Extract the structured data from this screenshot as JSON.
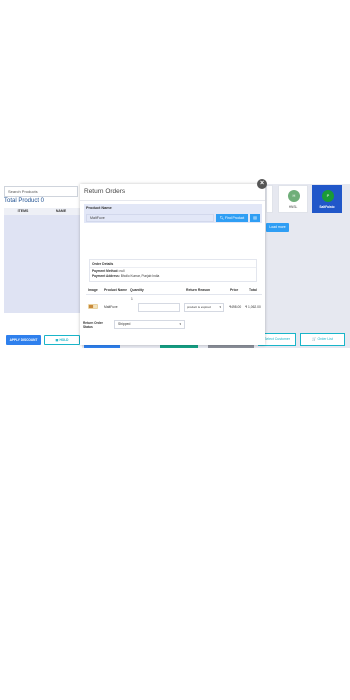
{
  "pos": {
    "search_placeholder": "Search Products",
    "total_label": "Total Product 0",
    "item_headers": [
      "ITEMS",
      "NAME"
    ],
    "apply_discount": "APPLY DISCOUNT",
    "hold": "HOLD",
    "hold_icon": "grid-icon",
    "customer_cards": [
      {
        "initial": "H",
        "name": "HNSL"
      },
      {
        "initial": "P",
        "name": "SaltFalsto"
      }
    ],
    "load_more": "Load more",
    "select_customer": "Select Customer",
    "order_list": "Order List",
    "order_list_icon": "cart-icon"
  },
  "modal": {
    "title": "Return Orders",
    "close_glyph": "×",
    "product_name_label": "Product Name",
    "product_name_value": "MaltFuve",
    "find_product": "Find Product",
    "find_icon": "search-icon",
    "barcode_icon": "barcode-icon",
    "order_details": {
      "title": "Order Details",
      "payment_method_label": "Payment Method:",
      "payment_method_value": "null",
      "payment_address_label": "Payment Address:",
      "payment_address_value": "Bhollo Kumar, Punjab India"
    },
    "table": {
      "headers": [
        "Image",
        "Product Name",
        "Quantity",
        "Return Reason",
        "Price",
        "Total"
      ],
      "rows": [
        {
          "product_name": "MaltFuve",
          "quantity": "1",
          "return_reason": "product is expired",
          "price": "₹498.00",
          "total": "₹ 1,062.00"
        }
      ]
    },
    "return_status_label": "Return Order Status",
    "return_status_value": "Shipped"
  },
  "colors": {
    "accent_blue": "#2f9ef4",
    "primary_blue": "#2f80ed",
    "teal": "#19b5c9",
    "active_card": "#2157c9"
  }
}
